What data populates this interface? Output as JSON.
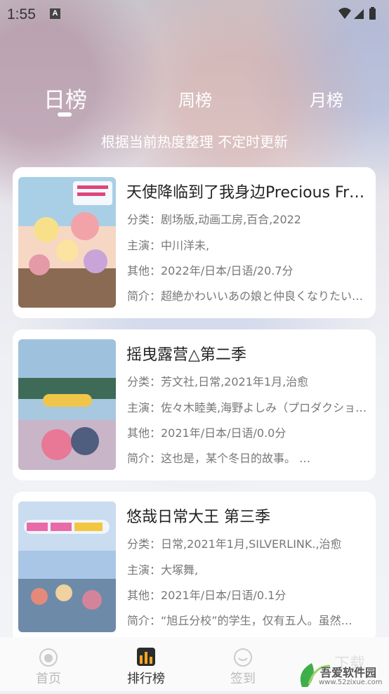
{
  "status": {
    "time": "1:55",
    "notification_badge": "A"
  },
  "tabs": [
    {
      "label": "日榜",
      "active": true
    },
    {
      "label": "周榜",
      "active": false
    },
    {
      "label": "月榜",
      "active": false
    }
  ],
  "subtitle": "根据当前热度整理 不定时更新",
  "items": [
    {
      "title": "天使降临到了我身边Precious Friends",
      "category": "分类：剧场版,动画工房,百合,2022",
      "cast": "主演：中川洋未,",
      "other": "其他：2022年/日本/日语/20.7分",
      "intro": "简介：超絶かわいいあの娘と仲良くなりたい…"
    },
    {
      "title": "摇曳露营△第二季",
      "category": "分类：芳文社,日常,2021年1月,治愈",
      "cast": "主演：佐々木睦美,海野よしみ（プロダクション）",
      "other": "其他：2021年/日本/日语/0.0分",
      "intro": "简介：这也是，某个冬日的故事。 …"
    },
    {
      "title": "悠哉日常大王 第三季",
      "category": "分类：日常,2021年1月,SILVERLINK.,治愈",
      "cast": "主演：大塚舞,",
      "other": "其他：2021年/日本/日语/0.1分",
      "intro": "简介：“旭丘分校”的学生，仅有五人。虽然…"
    }
  ],
  "nav": [
    {
      "label": "首页",
      "icon": "home-icon",
      "active": false
    },
    {
      "label": "排行榜",
      "icon": "ranking-icon",
      "active": true
    },
    {
      "label": "签到",
      "icon": "checkin-icon",
      "active": false
    }
  ],
  "watermark": {
    "brand": "吾爱软件园",
    "url": "www.52zixue.com"
  },
  "colors": {
    "accent": "#f5a623",
    "text": "#222222",
    "muted": "#777777"
  }
}
